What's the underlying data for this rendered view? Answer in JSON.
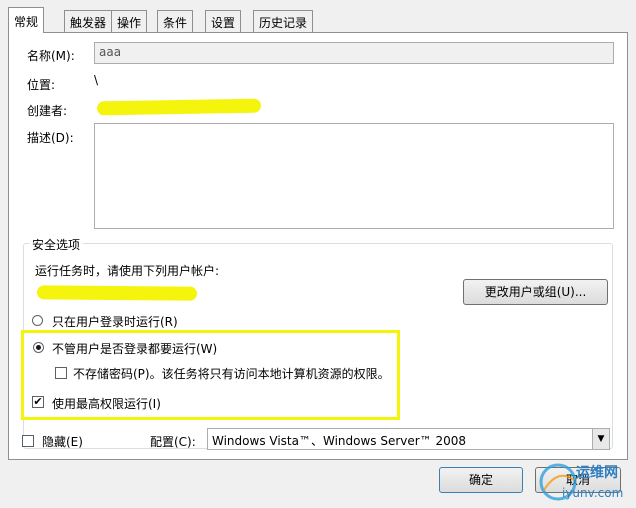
{
  "tabs": [
    "常规",
    "触发器",
    "操作",
    "条件",
    "设置",
    "历史记录"
  ],
  "general": {
    "name_label": "名称(M):",
    "name_value": "aaa",
    "location_label": "位置:",
    "location_value": "\\",
    "author_label": "创建者:",
    "description_label": "描述(D):",
    "description_value": ""
  },
  "security": {
    "group_title": "安全选项",
    "run_as_label": "运行任务时，请使用下列用户帐户:",
    "change_user_button": "更改用户或组(U)...",
    "option_logged_on": "只在用户登录时运行(R)",
    "option_whether_logged_on": "不管用户是否登录都要运行(W)",
    "option_no_store_password": "不存储密码(P)。该任务将只有访问本地计算机资源的权限。",
    "option_highest_privileges": "使用最高权限运行(I)",
    "state": {
      "logged_on_only": false,
      "whether_logged_on": true,
      "no_store_password": false,
      "highest_privileges": true
    }
  },
  "bottom": {
    "hidden_label": "隐藏(E)",
    "hidden_checked": false,
    "configure_label": "配置(C):",
    "configure_value": "Windows Vista™、Windows Server™ 2008"
  },
  "buttons": {
    "ok": "确定",
    "cancel": "取消"
  },
  "watermark": {
    "text_cn": "运维网",
    "text_url": "iyunv.com"
  },
  "colors": {
    "highlight": "#f3f300",
    "panel_bg": "#ffffff",
    "window_bg": "#f0f0f0"
  }
}
